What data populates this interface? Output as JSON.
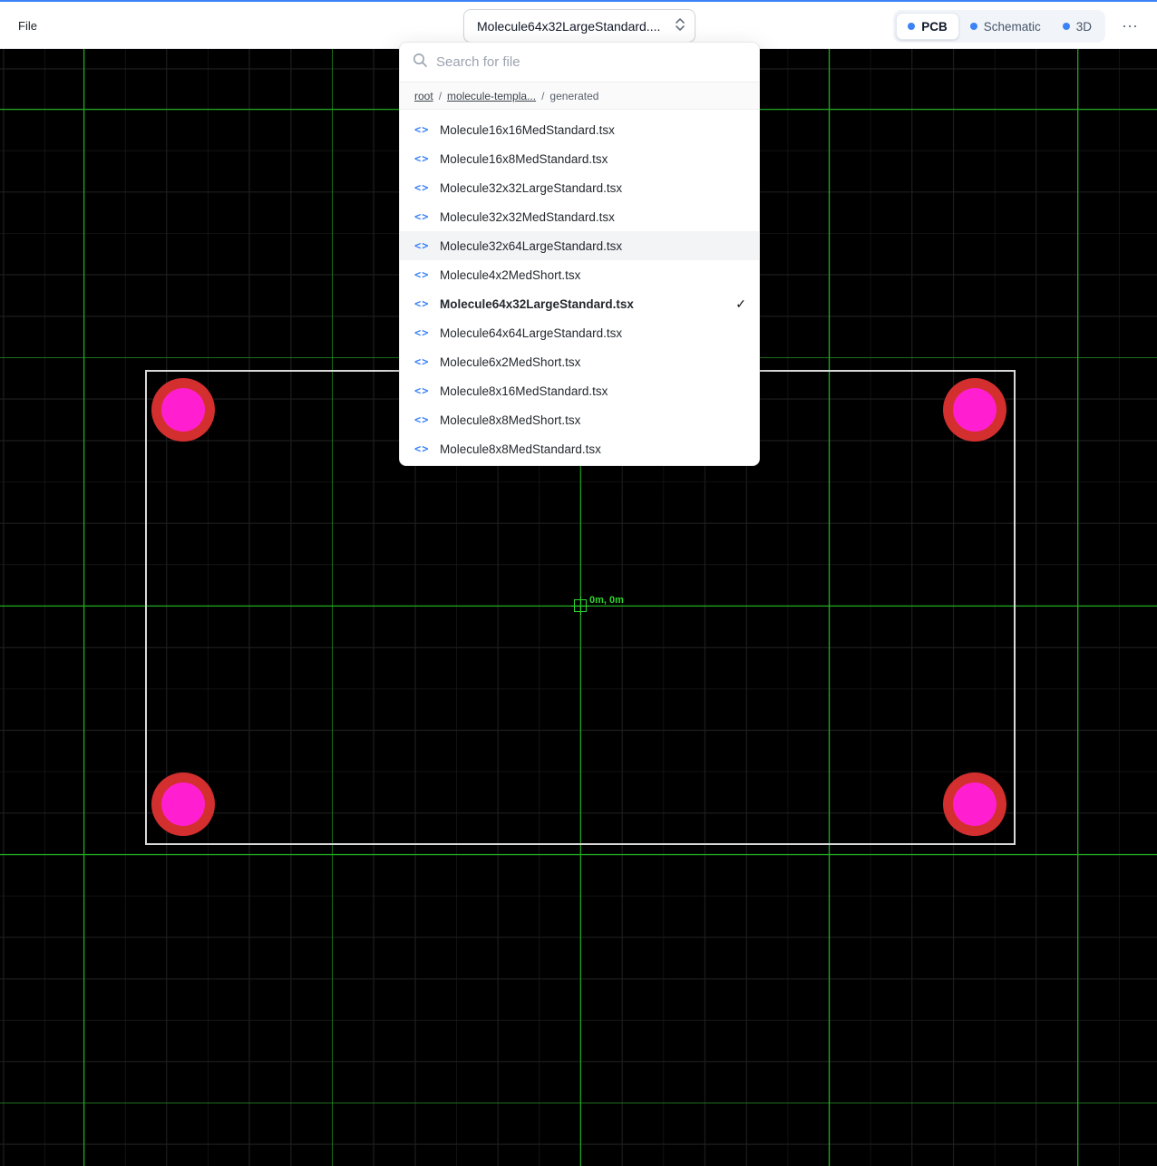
{
  "colors": {
    "accent_blue": "#3b82f6",
    "grid_major": "#1fae1f",
    "board_outline": "#d9d9d9",
    "pad_outer": "#d32f2f",
    "pad_inner": "#ff1fd0",
    "origin_green": "#2fd42f"
  },
  "icons": {
    "code": "<>",
    "check": "✓",
    "more": "⋯"
  },
  "menubar": {
    "file": "File"
  },
  "file_selector": {
    "value": "Molecule64x32LargeStandard...."
  },
  "view_switcher": {
    "options": [
      {
        "label": "PCB",
        "active": true
      },
      {
        "label": "Schematic",
        "active": false
      },
      {
        "label": "3D",
        "active": false
      }
    ]
  },
  "file_dropdown": {
    "search_placeholder": "Search for file",
    "breadcrumb": {
      "root": "root",
      "sep": "/",
      "middle": "molecule-templa...",
      "leaf": "generated"
    },
    "files": [
      {
        "name": "Molecule16x16MedStandard.tsx",
        "hover": false,
        "selected": false
      },
      {
        "name": "Molecule16x8MedStandard.tsx",
        "hover": false,
        "selected": false
      },
      {
        "name": "Molecule32x32LargeStandard.tsx",
        "hover": false,
        "selected": false
      },
      {
        "name": "Molecule32x32MedStandard.tsx",
        "hover": false,
        "selected": false
      },
      {
        "name": "Molecule32x64LargeStandard.tsx",
        "hover": true,
        "selected": false
      },
      {
        "name": "Molecule4x2MedShort.tsx",
        "hover": false,
        "selected": false
      },
      {
        "name": "Molecule64x32LargeStandard.tsx",
        "hover": false,
        "selected": true
      },
      {
        "name": "Molecule64x64LargeStandard.tsx",
        "hover": false,
        "selected": false
      },
      {
        "name": "Molecule6x2MedShort.tsx",
        "hover": false,
        "selected": false
      },
      {
        "name": "Molecule8x16MedStandard.tsx",
        "hover": false,
        "selected": false
      },
      {
        "name": "Molecule8x8MedShort.tsx",
        "hover": false,
        "selected": false
      },
      {
        "name": "Molecule8x8MedStandard.tsx",
        "hover": false,
        "selected": false
      }
    ]
  },
  "canvas": {
    "origin_label": "0m, 0m"
  }
}
